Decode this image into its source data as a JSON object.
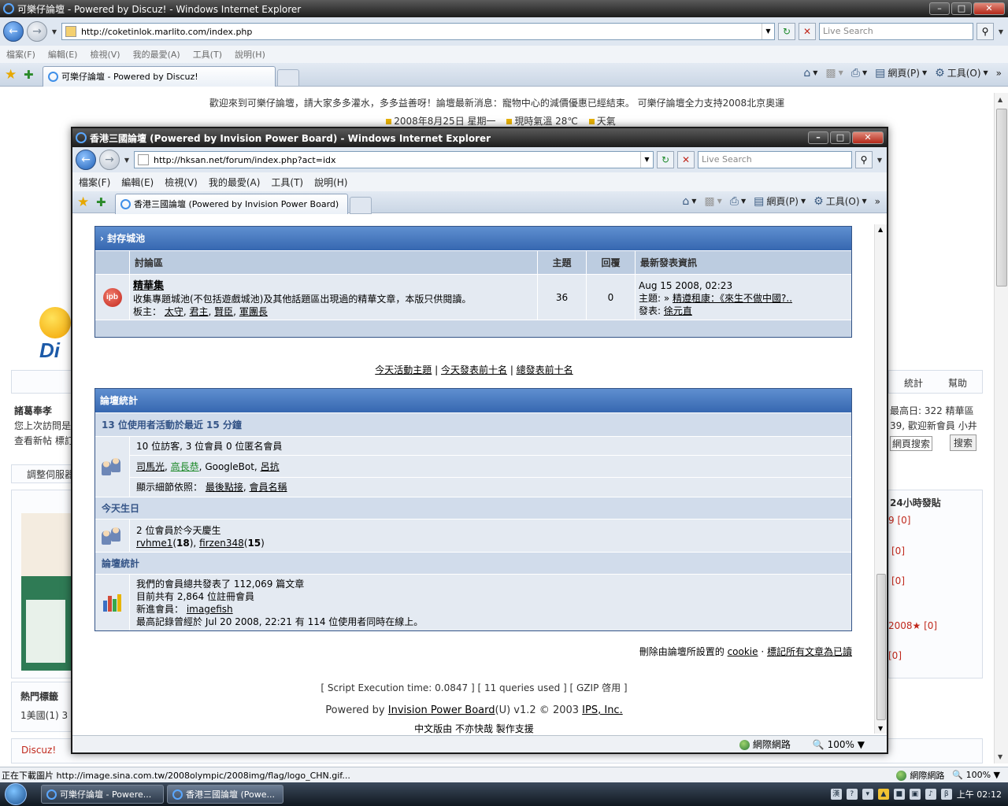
{
  "back_window": {
    "title": "可樂仔論壇 - Powered by Discuz! - Windows Internet Explorer",
    "url": "http://coketinlok.marlito.com/index.php",
    "search_placeholder": "Live Search",
    "menu": [
      "檔案(F)",
      "編輯(E)",
      "檢視(V)",
      "我的最愛(A)",
      "工具(T)",
      "說明(H)"
    ],
    "tab_title": "可樂仔論壇 - Powered by Discuz!",
    "cmd_page": "網頁(P)",
    "cmd_tools": "工具(O)",
    "welcome": "歡迎來到可樂仔論壇，請大家多多灌水，多多益善呀！論壇最新消息：寵物中心的減價優惠已經結束。 可樂仔論壇全力支持2008北京奧運",
    "date": "2008年8月25日 星期一",
    "temp": "現時氣溫 28℃",
    "weather": "天氣",
    "frag_user": "諸葛奉孝",
    "frag_last": "您上次訪問是",
    "frag_new": "查看新帖 標訂",
    "frag_adjust": "調整伺服器",
    "frag_tags": "熱門標籤",
    "frag_tag1": "1美國(1)  3",
    "frag_discuz": "Discuz!",
    "frag_stats": "統計",
    "frag_help": "幫助",
    "frag_high": "最高日: 322  精華區",
    "frag_welcome_new": "39, 歡迎新會員 小井",
    "frag_websearch": "網頁搜索",
    "frag_search_btn": "搜索",
    "frag_24h": "24小時發貼",
    "frag_counts": [
      "9 [0]",
      "[0]",
      "[0]",
      "2008★ [0]",
      "[0]"
    ],
    "status_text": "正在下載圖片 http://image.sina.com.tw/2008olympic/2008img/flag/logo_CHN.gif...",
    "zone": "網際網路",
    "zoom": "100%"
  },
  "front_window": {
    "title": "香港三國論壇 (Powered by Invision Power Board) - Windows Internet Explorer",
    "url": "http://hksan.net/forum/index.php?act=idx",
    "search_placeholder": "Live Search",
    "menu": [
      "檔案(F)",
      "編輯(E)",
      "檢視(V)",
      "我的最愛(A)",
      "工具(T)",
      "說明(H)"
    ],
    "tab_title": "香港三國論壇 (Powered by Invision Power Board)",
    "cmd_page": "網頁(P)",
    "cmd_tools": "工具(O)",
    "zone": "網際網路",
    "zoom": "100%"
  },
  "forum": {
    "category": "封存城池",
    "headers": {
      "forum": "討論區",
      "topics": "主題",
      "replies": "回覆",
      "last": "最新發表資訊"
    },
    "row": {
      "icon": "ipb",
      "name": "精華集",
      "desc": "收集專題城池(不包括遊戲城池)及其他話題區出現過的精華文章，本版只供閱讀。",
      "mods_label": "板主：",
      "mods": [
        "太守",
        "君主",
        "賢臣",
        "軍團長"
      ],
      "topics": "36",
      "replies": "0",
      "last_date": "Aug 15 2008, 02:23",
      "last_topic_label": "主題:",
      "last_topic": "精遵租康：《來生不做中國?..",
      "last_poster_label": "發表:",
      "last_poster": "徐元直"
    },
    "links": [
      "今天活動主題",
      "今天發表前十名",
      "總發表前十名"
    ],
    "stats_title": "論壇統計",
    "active_header": "13 位使用者活動於最近 15 分鐘",
    "active_counts": "10 位訪客, 3 位會員 0 位匿名會員",
    "active_users": [
      "司馬光",
      "高長恭",
      "GoogleBot",
      "呂抗"
    ],
    "active_users_colors": [
      "#000000",
      "#1e8a2b",
      "#000000",
      "#000000"
    ],
    "sort_label": "顯示細節依照：",
    "sort_options": [
      "最後點接",
      "會員名稱"
    ],
    "birthday_header": "今天生日",
    "birthday_count": "2 位會員於今天慶生",
    "birthdays": [
      {
        "name": "rvhme1",
        "age": "18"
      },
      {
        "name": "firzen348",
        "age": "15"
      }
    ],
    "board_header": "論壇統計",
    "posts_line": "我們的會員總共發表了 112,069 篇文章",
    "members_line": "目前共有 2,864 位註冊會員",
    "newest_label": "新進會員：",
    "newest": "imagefish",
    "record_line": "最高記錄曾經於 Jul 20 2008, 22:21 有 114 位使用者同時在線上。",
    "cookie_prefix": "刪除由論壇所設置的",
    "cookie_link": "cookie",
    "mark_read": "標記所有文章為已讀",
    "exec": "[ Script Execution time: 0.0847 ]   [ 11 queries used ]   [ GZIP 啓用 ]",
    "powered_prefix": "Powered by",
    "ipb_link": "Invision Power Board",
    "powered_suffix": "(U) v1.2 © 2003",
    "ips_link": "IPS, Inc.",
    "chinese": "中文版由 不亦快哉 製作支援"
  },
  "taskbar": {
    "items": [
      "可樂仔論壇 - Powere...",
      "香港三國論壇 (Powe..."
    ],
    "clock": "上午 02:12"
  }
}
